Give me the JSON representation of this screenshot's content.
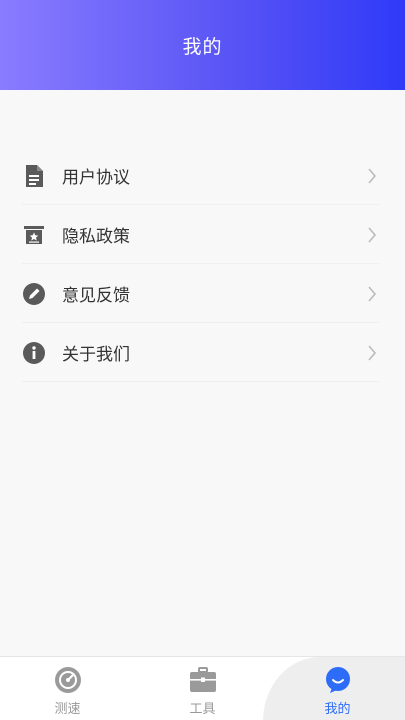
{
  "header": {
    "title": "我的"
  },
  "menu": {
    "items": [
      {
        "label": "用户协议",
        "icon": "document-icon"
      },
      {
        "label": "隐私政策",
        "icon": "privacy-icon"
      },
      {
        "label": "意见反馈",
        "icon": "pencil-icon"
      },
      {
        "label": "关于我们",
        "icon": "info-icon"
      }
    ]
  },
  "tabbar": {
    "tabs": [
      {
        "label": "测速",
        "icon": "speedometer-icon",
        "active": false
      },
      {
        "label": "工具",
        "icon": "toolbox-icon",
        "active": false
      },
      {
        "label": "我的",
        "icon": "chat-bubble-icon",
        "active": true
      }
    ]
  },
  "colors": {
    "header_gradient_start": "#8a7cff",
    "header_gradient_end": "#2f3af8",
    "active_tab": "#2c6cf6",
    "inactive_tab": "#999999",
    "icon_gray": "#5a5a5a"
  }
}
